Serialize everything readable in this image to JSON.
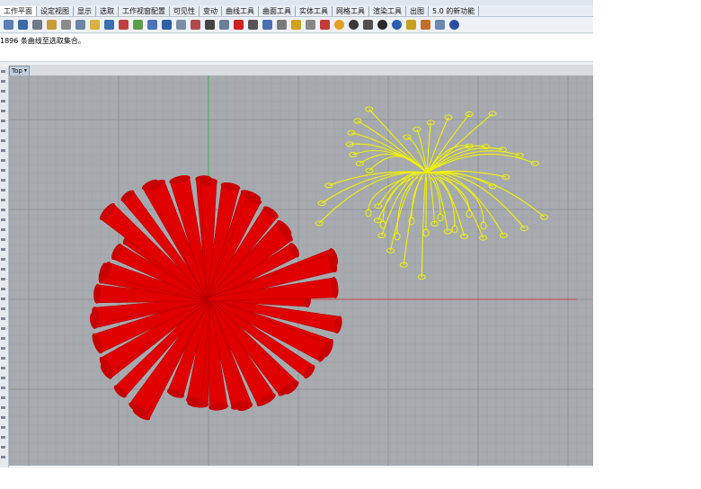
{
  "menu_tabs": [
    {
      "label": "工作平面"
    },
    {
      "label": "设定视图"
    },
    {
      "label": "显示"
    },
    {
      "label": "选取"
    },
    {
      "label": "工作视窗配置"
    },
    {
      "label": "可见性"
    },
    {
      "label": "变动"
    },
    {
      "label": "曲线工具"
    },
    {
      "label": "曲面工具"
    },
    {
      "label": "实体工具"
    },
    {
      "label": "网格工具"
    },
    {
      "label": "渲染工具"
    },
    {
      "label": "出图"
    },
    {
      "label": "5.0 的新功能"
    }
  ],
  "toolbar_icons": [
    "new-document-icon",
    "save-icon",
    "print-icon",
    "open-icon",
    "cut-icon",
    "copy-icon",
    "paste-icon",
    "undo-icon",
    "pan-hand-icon",
    "move-icon",
    "zoom-icon",
    "zoom-window-icon",
    "zoom-extents-icon",
    "zoom-selected-icon",
    "rotate-view-icon",
    "four-viewports-icon",
    "car-icon",
    "gumball-icon",
    "rotate-icon",
    "camera-icon",
    "light-bulb-icon",
    "lock-icon",
    "material-icon",
    "color-wheel-icon",
    "render-sphere-icon",
    "render-preview-icon",
    "shade-sphere-icon",
    "environment-icon",
    "dimension-icon",
    "grasshopper-icon",
    "layout-icon",
    "help-icon"
  ],
  "command_line": {
    "text": "1896 条曲线至选取集合。"
  },
  "viewport": {
    "label": "Top",
    "background": "#a7abb0",
    "grid_minor": "#9da1a6",
    "grid_major": "#8e9399"
  },
  "axes": {
    "x_color": "#c24a4a",
    "y_color": "#3cb04a"
  },
  "objects": {
    "mesh_color": "#e00000",
    "curve_color": "#f2f200"
  }
}
